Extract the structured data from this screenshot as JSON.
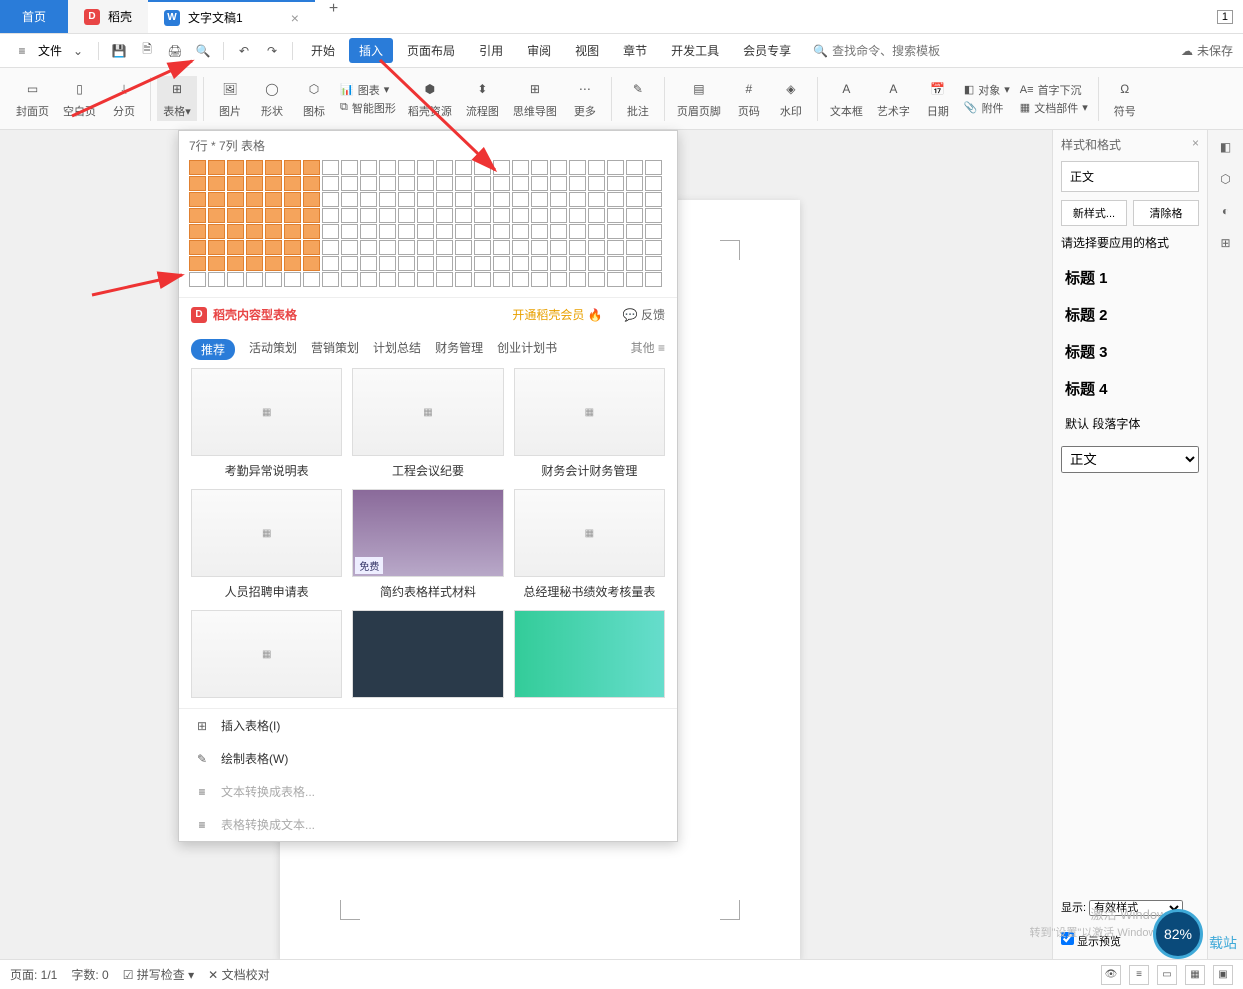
{
  "titlebar": {
    "tabs": [
      {
        "label": "首页",
        "type": "home"
      },
      {
        "label": "稻壳",
        "type": "doke"
      },
      {
        "label": "文字文稿1",
        "type": "doc",
        "active": true
      }
    ],
    "win_num": "1"
  },
  "menubar": {
    "file_label": "文件",
    "menus": [
      "开始",
      "插入",
      "页面布局",
      "引用",
      "审阅",
      "视图",
      "章节",
      "开发工具",
      "会员专享"
    ],
    "active_menu": "插入",
    "search_placeholder": "查找命令、搜索模板",
    "save_status": "未保存"
  },
  "ribbon": {
    "groups1": [
      {
        "label": "封面页",
        "icon": "▭"
      },
      {
        "label": "空白页",
        "icon": "▯"
      },
      {
        "label": "分页",
        "icon": "⤓"
      }
    ],
    "table_label": "表格",
    "groups2": [
      {
        "label": "图片",
        "icon": "🖼"
      },
      {
        "label": "形状",
        "icon": "◯"
      },
      {
        "label": "图标",
        "icon": "⬡"
      },
      {
        "label": "智能图形",
        "icon": "⧉"
      },
      {
        "label": "稻壳资源",
        "icon": "⬢"
      },
      {
        "label": "流程图",
        "icon": "⬍"
      },
      {
        "label": "思维导图",
        "icon": "⊞"
      },
      {
        "label": "更多",
        "icon": "⋯"
      }
    ],
    "groups3": [
      {
        "label": "批注",
        "icon": "✎"
      }
    ],
    "groups4": [
      {
        "label": "页眉页脚",
        "icon": "▤"
      },
      {
        "label": "页码",
        "icon": "#"
      },
      {
        "label": "水印",
        "icon": "◈"
      }
    ],
    "groups5": [
      {
        "label": "文本框",
        "icon": "A"
      },
      {
        "label": "艺术字",
        "icon": "A"
      },
      {
        "label": "日期",
        "icon": "📅"
      }
    ],
    "small_items": [
      {
        "label": "图表",
        "icon": "📊"
      },
      {
        "label": "对象",
        "icon": "◧"
      },
      {
        "label": "附件",
        "icon": "📎"
      },
      {
        "label": "首字下沉",
        "icon": "A≡"
      },
      {
        "label": "文档部件",
        "icon": "▦"
      }
    ],
    "symbol_label": "符号"
  },
  "table_popup": {
    "grid_label": "7行 * 7列 表格",
    "sel_rows": 7,
    "sel_cols": 7,
    "total_rows": 8,
    "total_cols": 25,
    "brand_title": "稻壳内容型表格",
    "vip_link": "开通稻壳会员",
    "feedback": "反馈",
    "tabs": [
      "推荐",
      "活动策划",
      "营销策划",
      "计划总结",
      "财务管理",
      "创业计划书"
    ],
    "active_tab": "推荐",
    "other_label": "其他",
    "templates": [
      {
        "cap": "考勤异常说明表"
      },
      {
        "cap": "工程会议纪要"
      },
      {
        "cap": "财务会计财务管理"
      },
      {
        "cap": "人员招聘申请表"
      },
      {
        "cap": "简约表格样式材料",
        "free": "免费"
      },
      {
        "cap": "总经理秘书绩效考核量表"
      }
    ],
    "menu": [
      {
        "label": "插入表格(I)",
        "icon": "⊞",
        "enabled": true
      },
      {
        "label": "绘制表格(W)",
        "icon": "✎",
        "enabled": true
      },
      {
        "label": "文本转换成表格...",
        "icon": "≡",
        "enabled": false
      },
      {
        "label": "表格转换成文本...",
        "icon": "≡",
        "enabled": false
      }
    ]
  },
  "style_panel": {
    "title": "样式和格式",
    "current": "正文",
    "new_btn": "新样式...",
    "clear_btn": "清除格",
    "apply_label": "请选择要应用的格式",
    "list": [
      "标题 1",
      "标题 2",
      "标题 3",
      "标题 4"
    ],
    "default_font": "默认 段落字体",
    "dropdown_value": "正文",
    "display_label": "显示:",
    "display_value": "有效样式",
    "preview_check": "显示预览"
  },
  "statusbar": {
    "page": "页面: 1/1",
    "words": "字数: 0",
    "spell": "拼写检查",
    "proof": "文档校对"
  },
  "activate": {
    "line1": "激活 Windows",
    "line2": "转到\"设置\"以激活 Windows。"
  },
  "zoom": "82%",
  "watermark": "载站"
}
